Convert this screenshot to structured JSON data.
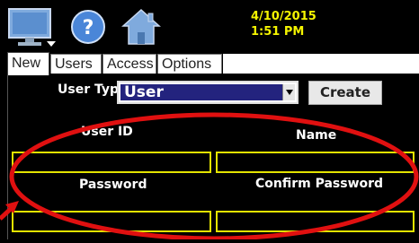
{
  "header": {
    "date": "4/10/2015",
    "time": "1:51 PM",
    "icons": [
      "monitor-icon",
      "help-icon",
      "home-icon"
    ],
    "datetime_color": "#f5f500"
  },
  "tabs": [
    {
      "label": "New",
      "active": true
    },
    {
      "label": "Users",
      "active": false
    },
    {
      "label": "Access",
      "active": false
    },
    {
      "label": "Options",
      "active": false
    }
  ],
  "form": {
    "user_type_label": "User Type",
    "user_type_value": "User",
    "create_label": "Create",
    "user_id_label": "User ID",
    "name_label": "Name",
    "password_label": "Password",
    "confirm_password_label": "Confirm Password",
    "user_id_value": "",
    "name_value": "",
    "password_value": "",
    "confirm_password_value": ""
  },
  "colors": {
    "field_border": "#e3e300",
    "selected_bg": "#23237e",
    "annotation": "#e01010"
  }
}
